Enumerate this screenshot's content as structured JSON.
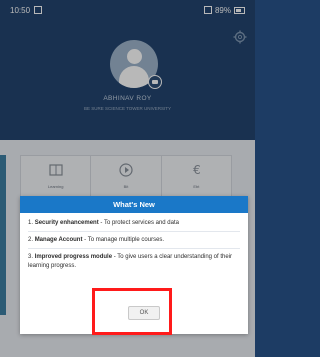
{
  "status_bar": {
    "time": "10:50",
    "battery": "89%"
  },
  "header": {
    "user_name": "ABHINAV ROY",
    "user_subtitle": "BE SURE SCIENCE TOWER UNIVERSITY",
    "icons": {
      "settings": "gear-icon",
      "avatar": "user-avatar",
      "camera": "camera-icon"
    }
  },
  "menu": {
    "items": [
      {
        "label": "Learning",
        "icon": "book-icon"
      },
      {
        "label": "Bit",
        "icon": "play-circle-icon"
      },
      {
        "label": "Ebt",
        "icon": "currency-icon"
      }
    ]
  },
  "modal": {
    "title": "What's New",
    "items": [
      {
        "number": "1.",
        "title": "Security enhancement",
        "text": " - To protect services and data"
      },
      {
        "number": "2.",
        "title": "Manage Account",
        "text": " - To manage multiple courses."
      },
      {
        "number": "3.",
        "title": "Improved progress module",
        "text": " - To give users a clear understanding of their learning progress."
      }
    ],
    "ok_label": "OK"
  },
  "colors": {
    "header_bg": "#23456f",
    "accent": "#1a78c8",
    "highlight": "#ff1a1a"
  }
}
